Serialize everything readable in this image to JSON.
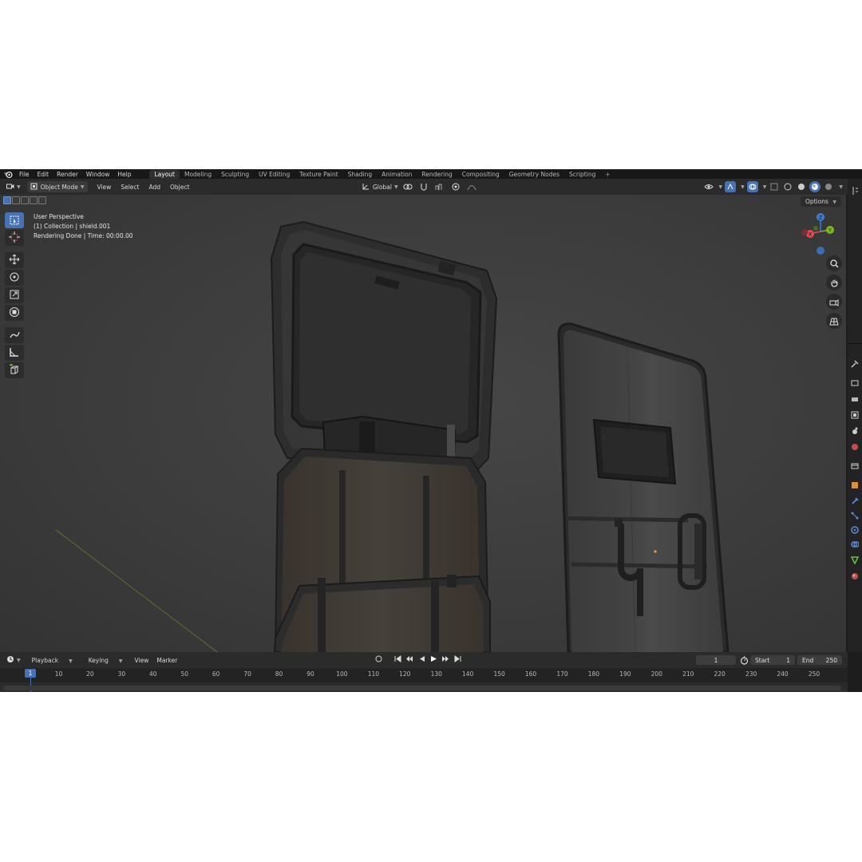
{
  "menubar": {
    "items": [
      "File",
      "Edit",
      "Render",
      "Window",
      "Help"
    ],
    "workspaces": [
      "Layout",
      "Modeling",
      "Sculpting",
      "UV Editing",
      "Texture Paint",
      "Shading",
      "Animation",
      "Rendering",
      "Compositing",
      "Geometry Nodes",
      "Scripting"
    ],
    "active_workspace": "Layout",
    "add_tab": "+"
  },
  "viewport_header": {
    "mode": "Object Mode",
    "menus": [
      "View",
      "Select",
      "Add",
      "Object"
    ],
    "transform_orientation": "Global",
    "options_label": "Options"
  },
  "overlay": {
    "line1": "User Perspective",
    "line2": "(1) Collection | shield.001",
    "line3": "Rendering Done | Time: 00:00.00"
  },
  "gizmo": {
    "z": "Z",
    "y": "Y",
    "x": "X",
    "colors": {
      "x": "#e04a55",
      "y": "#7cb81f",
      "z": "#3d7ed8"
    }
  },
  "timeline": {
    "menus": [
      "Playback",
      "Keying",
      "View",
      "Marker"
    ],
    "current_frame": "1",
    "start_label": "Start",
    "start_value": "1",
    "end_label": "End",
    "end_value": "250",
    "ruler_current": "1",
    "ticks": [
      "10",
      "20",
      "30",
      "40",
      "50",
      "60",
      "70",
      "80",
      "90",
      "100",
      "110",
      "120",
      "130",
      "140",
      "150",
      "160",
      "170",
      "180",
      "190",
      "200",
      "210",
      "220",
      "230",
      "240",
      "250"
    ]
  },
  "colors": {
    "accent": "#4772b3",
    "header_bg": "#2b2b2b",
    "viewport_bg": "#3d3d3d"
  }
}
